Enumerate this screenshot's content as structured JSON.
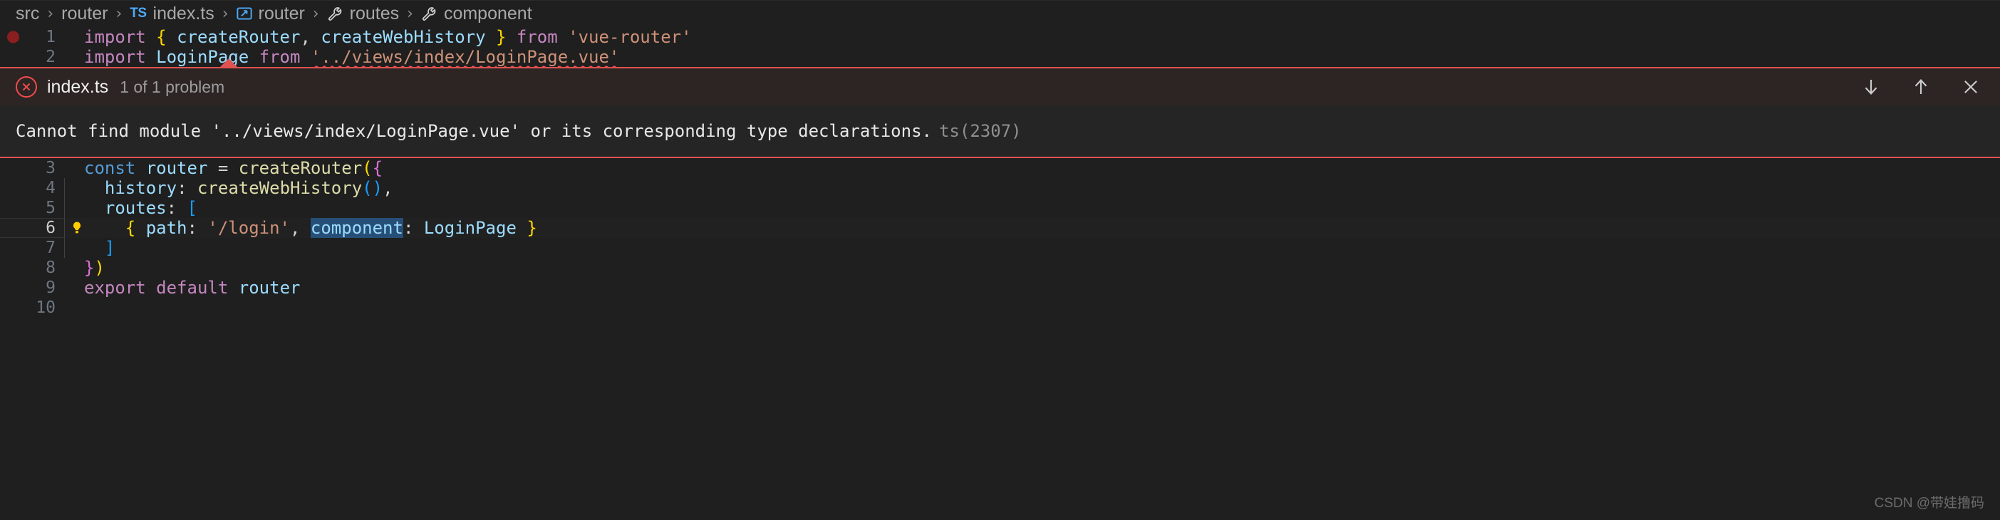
{
  "breadcrumb": {
    "items": [
      {
        "label": "src",
        "icon": null
      },
      {
        "label": "router",
        "icon": null
      },
      {
        "label": "index.ts",
        "icon": "typescript-file-icon"
      },
      {
        "label": "router",
        "icon": "variable-symbol-icon"
      },
      {
        "label": "routes",
        "icon": "property-symbol-icon"
      },
      {
        "label": "component",
        "icon": "property-symbol-icon"
      }
    ],
    "separator": "›"
  },
  "code_top": {
    "lines": [
      {
        "number": "1",
        "breakpoint": true,
        "text": "import { createRouter, createWebHistory } from 'vue-router'",
        "tokens": [
          {
            "t": "import",
            "c": "kw"
          },
          {
            "t": " ",
            "c": "plain"
          },
          {
            "t": "{",
            "c": "br-y"
          },
          {
            "t": " ",
            "c": "plain"
          },
          {
            "t": "createRouter",
            "c": "var"
          },
          {
            "t": ",",
            "c": "plain"
          },
          {
            "t": " ",
            "c": "plain"
          },
          {
            "t": "createWebHistory",
            "c": "var"
          },
          {
            "t": " ",
            "c": "plain"
          },
          {
            "t": "}",
            "c": "br-y"
          },
          {
            "t": " ",
            "c": "plain"
          },
          {
            "t": "from",
            "c": "kw"
          },
          {
            "t": " ",
            "c": "plain"
          },
          {
            "t": "'vue-router'",
            "c": "str"
          }
        ]
      },
      {
        "number": "2",
        "breakpoint": false,
        "text": "import LoginPage from '../views/index/LoginPage.vue'",
        "tokens": [
          {
            "t": "import",
            "c": "kw"
          },
          {
            "t": " ",
            "c": "plain"
          },
          {
            "t": "LoginPage",
            "c": "var"
          },
          {
            "t": " ",
            "c": "plain"
          },
          {
            "t": "from",
            "c": "kw"
          },
          {
            "t": " ",
            "c": "plain"
          },
          {
            "t": "'../views/index/LoginPage.vue'",
            "c": "str squiggle"
          }
        ]
      }
    ]
  },
  "peek": {
    "icon": "error-circle-icon",
    "file": "index.ts",
    "count": "1 of 1 problem",
    "actions": [
      {
        "name": "next-problem",
        "glyph": "↓"
      },
      {
        "name": "previous-problem",
        "glyph": "↑"
      },
      {
        "name": "close-peek",
        "glyph": "✕"
      }
    ],
    "message": "Cannot find module '../views/index/LoginPage.vue' or its corresponding type declarations.",
    "code": "ts(2307)"
  },
  "code_bottom": {
    "lines": [
      {
        "number": "3",
        "active": false,
        "indent_guides": 0,
        "tokens": [
          {
            "t": "const",
            "c": "kw2"
          },
          {
            "t": " ",
            "c": "plain"
          },
          {
            "t": "router",
            "c": "var"
          },
          {
            "t": " ",
            "c": "plain"
          },
          {
            "t": "=",
            "c": "plain"
          },
          {
            "t": " ",
            "c": "plain"
          },
          {
            "t": "createRouter",
            "c": "fn"
          },
          {
            "t": "(",
            "c": "br-y"
          },
          {
            "t": "{",
            "c": "br-p"
          }
        ]
      },
      {
        "number": "4",
        "active": false,
        "indent_guides": 1,
        "tokens": [
          {
            "t": "  ",
            "c": "plain"
          },
          {
            "t": "history",
            "c": "var"
          },
          {
            "t": ":",
            "c": "plain"
          },
          {
            "t": " ",
            "c": "plain"
          },
          {
            "t": "createWebHistory",
            "c": "fn"
          },
          {
            "t": "(",
            "c": "br-b"
          },
          {
            "t": ")",
            "c": "br-b"
          },
          {
            "t": ",",
            "c": "plain"
          }
        ]
      },
      {
        "number": "5",
        "active": false,
        "indent_guides": 1,
        "tokens": [
          {
            "t": "  ",
            "c": "plain"
          },
          {
            "t": "routes",
            "c": "var"
          },
          {
            "t": ":",
            "c": "plain"
          },
          {
            "t": " ",
            "c": "plain"
          },
          {
            "t": "[",
            "c": "br-b"
          }
        ]
      },
      {
        "number": "6",
        "active": true,
        "bulb": true,
        "indent_guides": 1,
        "tokens": [
          {
            "t": "    ",
            "c": "plain"
          },
          {
            "t": "{",
            "c": "br-y"
          },
          {
            "t": " ",
            "c": "plain"
          },
          {
            "t": "path",
            "c": "var"
          },
          {
            "t": ":",
            "c": "plain"
          },
          {
            "t": " ",
            "c": "plain"
          },
          {
            "t": "'/login'",
            "c": "str"
          },
          {
            "t": ",",
            "c": "plain"
          },
          {
            "t": " ",
            "c": "plain"
          },
          {
            "t": "component",
            "c": "var sel"
          },
          {
            "t": ":",
            "c": "plain"
          },
          {
            "t": " ",
            "c": "plain"
          },
          {
            "t": "LoginPage",
            "c": "var"
          },
          {
            "t": " ",
            "c": "plain"
          },
          {
            "t": "}",
            "c": "br-y"
          }
        ]
      },
      {
        "number": "7",
        "active": false,
        "indent_guides": 1,
        "tokens": [
          {
            "t": "  ",
            "c": "plain"
          },
          {
            "t": "]",
            "c": "br-b"
          }
        ]
      },
      {
        "number": "8",
        "active": false,
        "indent_guides": 0,
        "tokens": [
          {
            "t": "}",
            "c": "br-p"
          },
          {
            "t": ")",
            "c": "br-y"
          }
        ]
      },
      {
        "number": "9",
        "active": false,
        "indent_guides": 0,
        "tokens": [
          {
            "t": "export",
            "c": "kw"
          },
          {
            "t": " ",
            "c": "plain"
          },
          {
            "t": "default",
            "c": "kw"
          },
          {
            "t": " ",
            "c": "plain"
          },
          {
            "t": "router",
            "c": "var"
          }
        ]
      },
      {
        "number": "10",
        "active": false,
        "indent_guides": 0,
        "tokens": []
      }
    ]
  },
  "watermark": "CSDN @带娃撸码",
  "colors": {
    "editor_bg": "#1f1f1f",
    "error_accent": "#e05252",
    "selection": "#264f78",
    "breakpoint": "#8b1f1f"
  }
}
